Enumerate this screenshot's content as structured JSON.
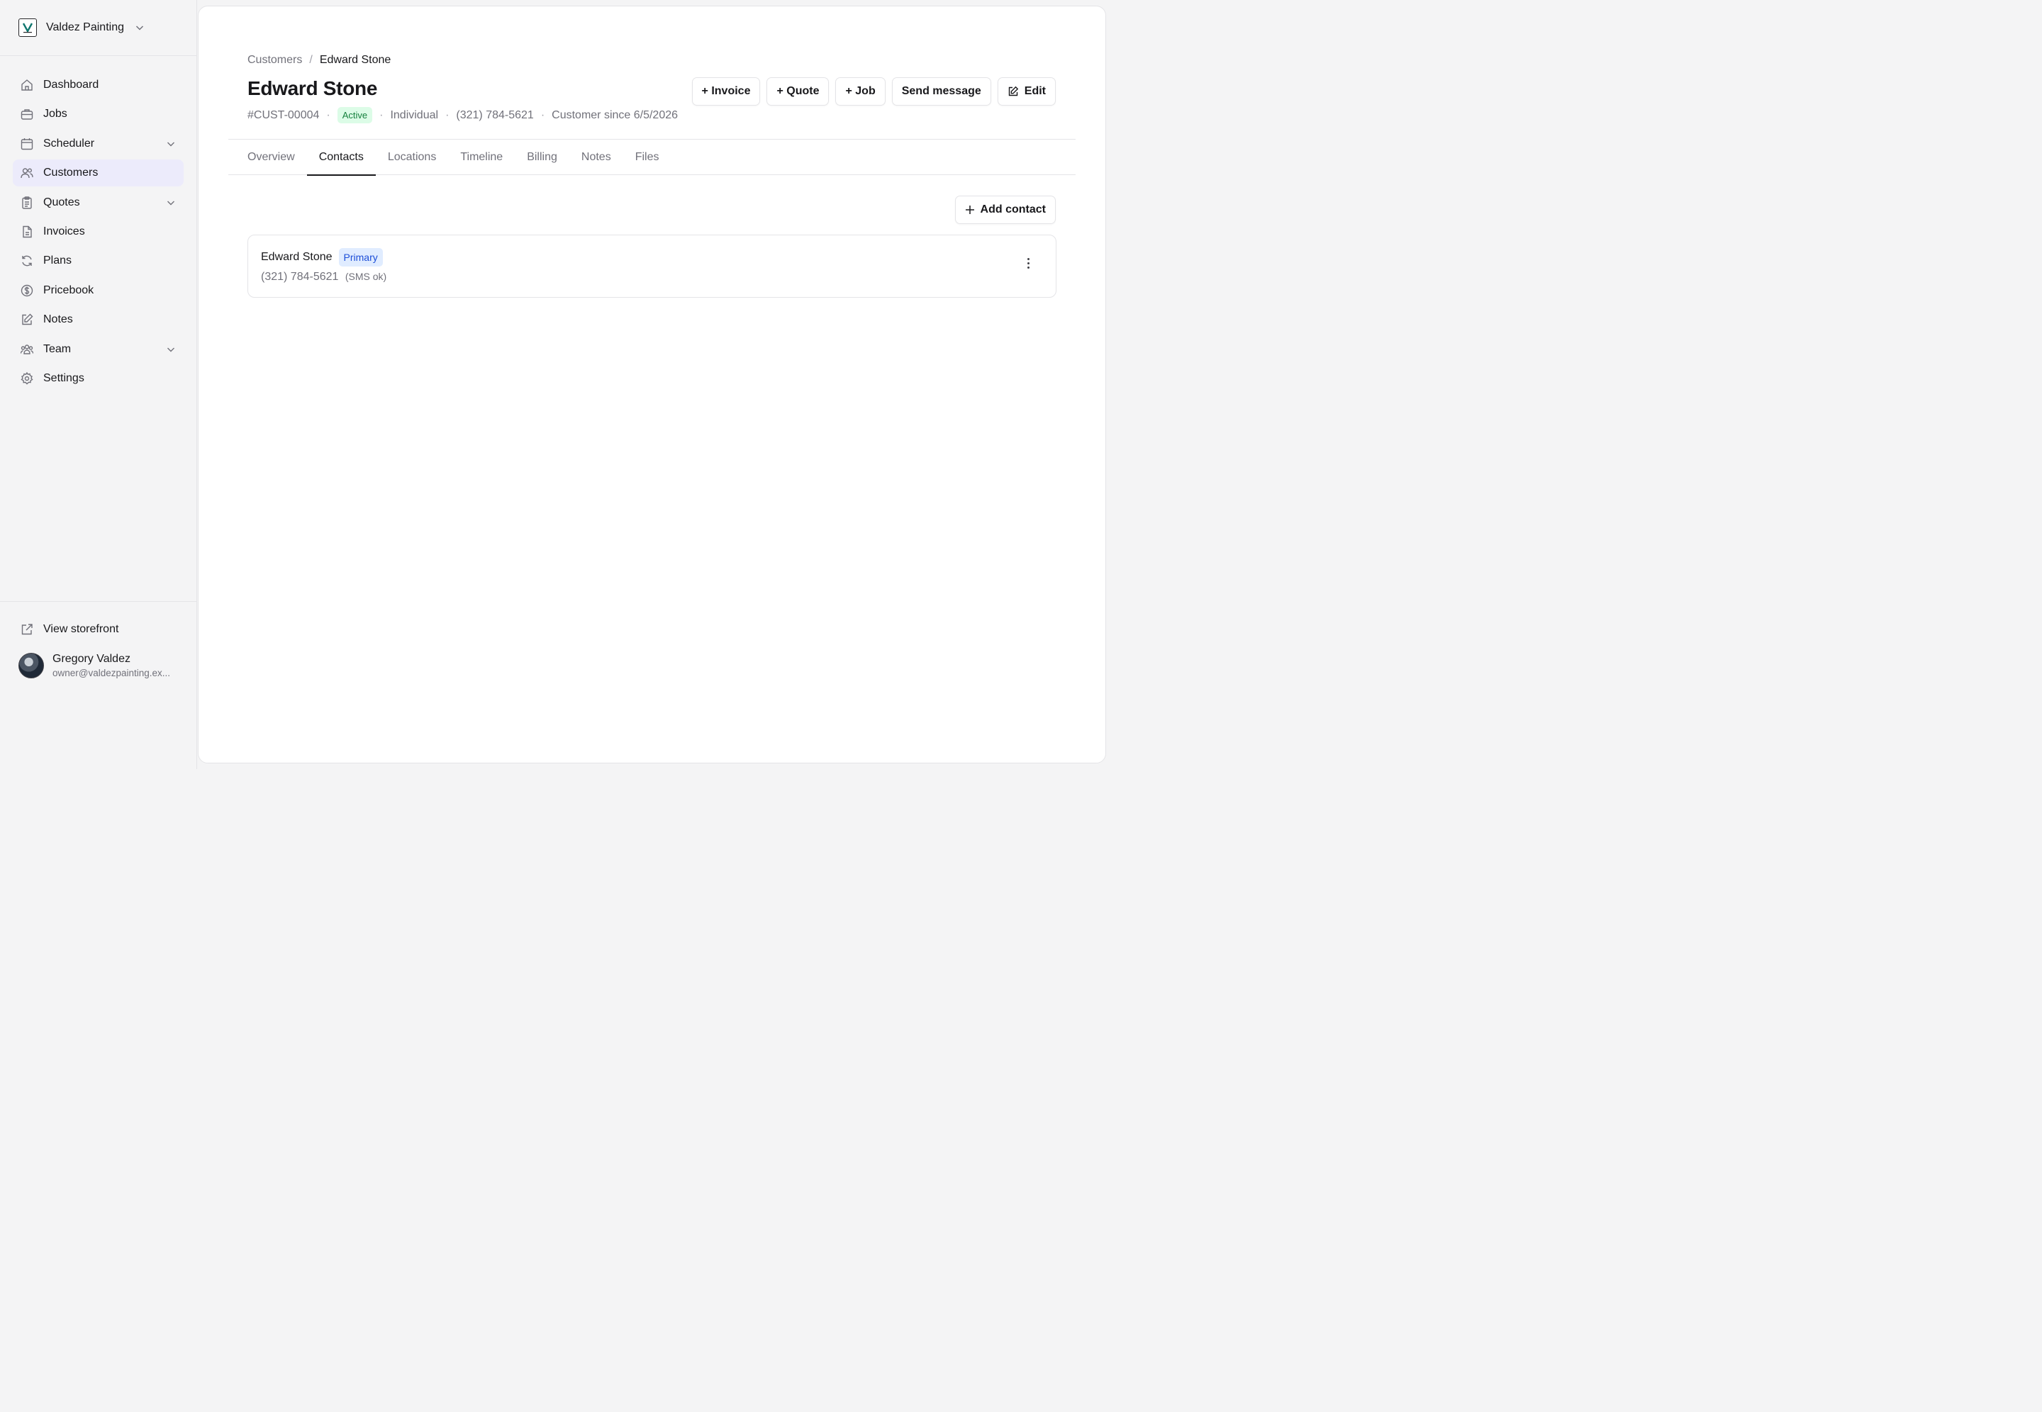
{
  "org": {
    "name": "Valdez Painting",
    "logo_letter": "V"
  },
  "nav": {
    "items": [
      {
        "label": "Dashboard",
        "icon": "home-icon",
        "active": false,
        "expandable": false
      },
      {
        "label": "Jobs",
        "icon": "briefcase-icon",
        "active": false,
        "expandable": false
      },
      {
        "label": "Scheduler",
        "icon": "calendar-icon",
        "active": false,
        "expandable": true
      },
      {
        "label": "Customers",
        "icon": "users-icon",
        "active": true,
        "expandable": false
      },
      {
        "label": "Quotes",
        "icon": "clipboard-icon",
        "active": false,
        "expandable": true
      },
      {
        "label": "Invoices",
        "icon": "file-icon",
        "active": false,
        "expandable": false
      },
      {
        "label": "Plans",
        "icon": "refresh-icon",
        "active": false,
        "expandable": false
      },
      {
        "label": "Pricebook",
        "icon": "dollar-icon",
        "active": false,
        "expandable": false
      },
      {
        "label": "Notes",
        "icon": "edit-icon",
        "active": false,
        "expandable": false
      },
      {
        "label": "Team",
        "icon": "team-icon",
        "active": false,
        "expandable": true
      },
      {
        "label": "Settings",
        "icon": "gear-icon",
        "active": false,
        "expandable": false
      }
    ]
  },
  "footer": {
    "storefront_label": "View storefront",
    "user_name": "Gregory Valdez",
    "user_email": "owner@valdezpainting.ex..."
  },
  "breadcrumb": {
    "parent": "Customers",
    "separator": "/",
    "current": "Edward Stone"
  },
  "customer": {
    "name": "Edward Stone",
    "id": "#CUST-00004",
    "status": "Active",
    "type": "Individual",
    "phone": "(321) 784-5621",
    "since": "Customer since 6/5/2026"
  },
  "actions": {
    "invoice": "+ Invoice",
    "quote": "+ Quote",
    "job": "+ Job",
    "message": "Send message",
    "edit": "Edit"
  },
  "tabs": [
    "Overview",
    "Contacts",
    "Locations",
    "Timeline",
    "Billing",
    "Notes",
    "Files"
  ],
  "active_tab": "Contacts",
  "contacts": {
    "add_label": "Add contact",
    "items": [
      {
        "name": "Edward Stone",
        "badge": "Primary",
        "phone": "(321) 784-5621",
        "sms": "(SMS ok)"
      }
    ]
  },
  "colors": {
    "active_nav_bg": "#ecebfb",
    "active_badge_bg": "#dcfce7",
    "primary_badge_bg": "#e0ecff"
  }
}
